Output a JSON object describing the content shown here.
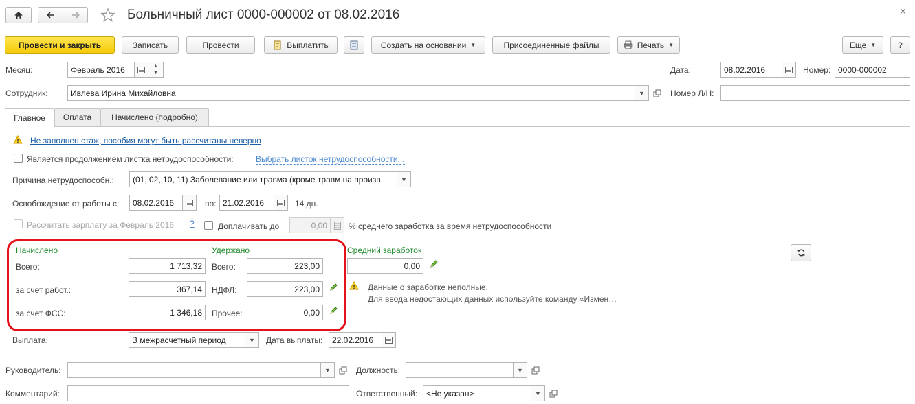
{
  "window": {
    "title": "Больничный лист 0000-000002 от 08.02.2016"
  },
  "toolbar": {
    "post_close": "Провести и закрыть",
    "save": "Записать",
    "post": "Провести",
    "pay": "Выплатить",
    "create_based": "Создать на основании",
    "attached_files": "Присоединенные файлы",
    "print": "Печать",
    "more": "Еще",
    "help": "?"
  },
  "header": {
    "month_label": "Месяц:",
    "month_value": "Февраль 2016",
    "date_label": "Дата:",
    "date_value": "08.02.2016",
    "number_label": "Номер:",
    "number_value": "0000-000002",
    "employee_label": "Сотрудник:",
    "employee_value": "Ивлева Ирина Михайловна",
    "ln_number_label": "Номер Л/Н:",
    "ln_number_value": ""
  },
  "tabs": [
    {
      "label": "Главное",
      "active": true
    },
    {
      "label": "Оплата",
      "active": false
    },
    {
      "label": "Начислено (подробно)",
      "active": false
    }
  ],
  "main": {
    "warning_link": "Не заполнен стаж, пособия могут быть рассчитаны неверно",
    "continuation_label": "Является продолжением листка нетрудоспособности:",
    "continuation_link": "Выбрать листок нетрудоспособности...",
    "reason_label": "Причина нетрудоспособн.:",
    "reason_value": "(01, 02, 10, 11) Заболевание или травма (кроме травм на произв",
    "release_label": "Освобождение от работы с:",
    "release_from": "08.02.2016",
    "release_to_label": "по:",
    "release_to": "21.02.2016",
    "days": "14 дн.",
    "calc_salary_label": "Рассчитать зарплату за Февраль 2016",
    "calc_salary_help": "?",
    "topup_label": "Доплачивать до",
    "topup_value": "0,00",
    "topup_suffix": "% среднего заработка за время нетрудоспособности"
  },
  "accrued": {
    "title": "Начислено",
    "total_label": "Всего:",
    "total_value": "1 713,32",
    "employer_label": "за счет работ.:",
    "employer_value": "367,14",
    "fss_label": "за счет ФСС:",
    "fss_value": "1 346,18"
  },
  "withheld": {
    "title": "Удержано",
    "total_label": "Всего:",
    "total_value": "223,00",
    "ndfl_label": "НДФЛ:",
    "ndfl_value": "223,00",
    "other_label": "Прочее:",
    "other_value": "0,00"
  },
  "average": {
    "title": "Средний заработок",
    "value": "0,00",
    "warning_line1": "Данные о заработке неполные.",
    "warning_line2": "Для ввода недостающих данных используйте команду «Измен…"
  },
  "payment": {
    "label": "Выплата:",
    "value": "В межрасчетный период",
    "date_label": "Дата выплаты:",
    "date_value": "22.02.2016"
  },
  "footer": {
    "manager_label": "Руководитель:",
    "manager_value": "",
    "position_label": "Должность:",
    "position_value": "",
    "comment_label": "Комментарий:",
    "comment_value": "",
    "responsible_label": "Ответственный:",
    "responsible_value": "<Не указан>"
  },
  "colors": {
    "primary_button": "#f5cb0c",
    "section_title": "#1f8a2c",
    "highlight_frame": "#e3121b",
    "link": "#1c5fa8"
  }
}
